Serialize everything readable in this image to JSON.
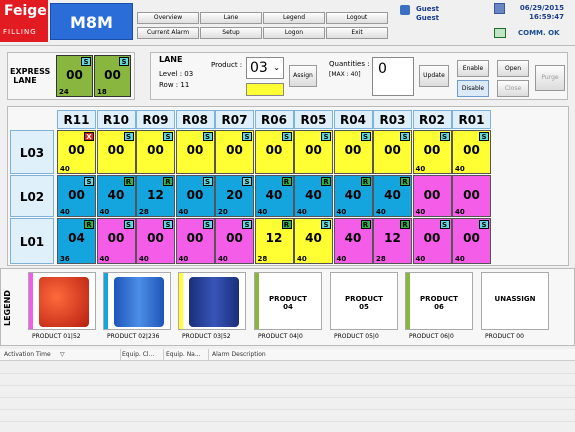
{
  "header": {
    "brand": "Feige",
    "brand_sub": "FILLING",
    "app_title": "M8M",
    "nav": [
      {
        "label": "Overview"
      },
      {
        "label": "Lane"
      },
      {
        "label": "Legend"
      },
      {
        "label": "Logout"
      },
      {
        "label": "Current Alarm"
      },
      {
        "label": "Setup"
      },
      {
        "label": "Logon"
      },
      {
        "label": "Exit"
      }
    ],
    "user_line1": "Guest",
    "user_line2": "Guest",
    "date": "06/29/2015",
    "time": "16:59:47",
    "comm_status": "COMM. OK"
  },
  "express_lane": {
    "label_line1": "EXPRESS",
    "label_line2": "LANE",
    "cells": [
      {
        "num": "00",
        "qty": "24",
        "badge": "S"
      },
      {
        "num": "00",
        "qty": "18",
        "badge": "S"
      }
    ]
  },
  "lane": {
    "title": "LANE",
    "level": "Level : 03",
    "row": "Row   : 11",
    "product_label": "Product :",
    "product_value": "03",
    "assign_label": "Assign",
    "quantities_label": "Quantities :",
    "max_label": "[MAX : 40]",
    "quantity_value": "0",
    "update_label": "Update",
    "enable_label": "Enable",
    "disable_label": "Disable",
    "open_label": "Open",
    "close_label": "Close",
    "purge_label": "Purge"
  },
  "grid": {
    "columns": [
      "R11",
      "R10",
      "R09",
      "R08",
      "R07",
      "R06",
      "R05",
      "R04",
      "R03",
      "R02",
      "R01"
    ],
    "rows": [
      {
        "label": "L03",
        "cells": [
          {
            "num": "00",
            "qty": "40",
            "badge": "X",
            "color": "y"
          },
          {
            "num": "00",
            "qty": "",
            "badge": "S",
            "color": "y"
          },
          {
            "num": "00",
            "qty": "",
            "badge": "S",
            "color": "y"
          },
          {
            "num": "00",
            "qty": "",
            "badge": "S",
            "color": "y"
          },
          {
            "num": "00",
            "qty": "",
            "badge": "S",
            "color": "y"
          },
          {
            "num": "00",
            "qty": "",
            "badge": "S",
            "color": "y"
          },
          {
            "num": "00",
            "qty": "",
            "badge": "S",
            "color": "y"
          },
          {
            "num": "00",
            "qty": "",
            "badge": "S",
            "color": "y"
          },
          {
            "num": "00",
            "qty": "",
            "badge": "S",
            "color": "y"
          },
          {
            "num": "00",
            "qty": "40",
            "badge": "S",
            "color": "y"
          },
          {
            "num": "00",
            "qty": "40",
            "badge": "S",
            "color": "y"
          }
        ]
      },
      {
        "label": "L02",
        "cells": [
          {
            "num": "00",
            "qty": "40",
            "badge": "S",
            "color": "b"
          },
          {
            "num": "40",
            "qty": "40",
            "badge": "R",
            "color": "b"
          },
          {
            "num": "12",
            "qty": "28",
            "badge": "R",
            "color": "b"
          },
          {
            "num": "00",
            "qty": "40",
            "badge": "S",
            "color": "b"
          },
          {
            "num": "20",
            "qty": "20",
            "badge": "S",
            "color": "b"
          },
          {
            "num": "40",
            "qty": "40",
            "badge": "R",
            "color": "b"
          },
          {
            "num": "40",
            "qty": "40",
            "badge": "R",
            "color": "b"
          },
          {
            "num": "40",
            "qty": "40",
            "badge": "R",
            "color": "b"
          },
          {
            "num": "40",
            "qty": "40",
            "badge": "R",
            "color": "b"
          },
          {
            "num": "00",
            "qty": "40",
            "badge": "",
            "color": "p"
          },
          {
            "num": "00",
            "qty": "40",
            "badge": "",
            "color": "p"
          }
        ]
      },
      {
        "label": "L01",
        "cells": [
          {
            "num": "04",
            "qty": "36",
            "badge": "R",
            "color": "b"
          },
          {
            "num": "00",
            "qty": "40",
            "badge": "S",
            "color": "p"
          },
          {
            "num": "00",
            "qty": "40",
            "badge": "S",
            "color": "p"
          },
          {
            "num": "00",
            "qty": "40",
            "badge": "S",
            "color": "p"
          },
          {
            "num": "00",
            "qty": "40",
            "badge": "S",
            "color": "p"
          },
          {
            "num": "12",
            "qty": "28",
            "badge": "R",
            "color": "y"
          },
          {
            "num": "40",
            "qty": "40",
            "badge": "S",
            "color": "y"
          },
          {
            "num": "40",
            "qty": "40",
            "badge": "R",
            "color": "p"
          },
          {
            "num": "12",
            "qty": "28",
            "badge": "R",
            "color": "p"
          },
          {
            "num": "00",
            "qty": "40",
            "badge": "S",
            "color": "p"
          },
          {
            "num": "00",
            "qty": "40",
            "badge": "S",
            "color": "p"
          }
        ]
      }
    ]
  },
  "legend": {
    "title": "LEGEND",
    "items": [
      {
        "caption": "PRODUCT 01|52",
        "text": "",
        "stripe": "#f45de8",
        "image": "total-drum-icon"
      },
      {
        "caption": "PRODUCT 02|236",
        "text": "",
        "stripe": "#14a5df",
        "image": "elf-drum-icon"
      },
      {
        "caption": "PRODUCT 03|52",
        "text": "",
        "stripe": "#ffff33",
        "image": "blue-drum-icon"
      },
      {
        "caption": "PRODUCT 04|0",
        "text": "PRODUCT\n04",
        "stripe": "#88b63f",
        "image": ""
      },
      {
        "caption": "PRODUCT 05|0",
        "text": "PRODUCT\n05",
        "stripe": "#ffffff",
        "image": ""
      },
      {
        "caption": "PRODUCT 06|0",
        "text": "PRODUCT\n06",
        "stripe": "#88b63f",
        "image": ""
      },
      {
        "caption": "PRODUCT 00",
        "text": "UNASSIGN",
        "stripe": "#ffffff",
        "image": ""
      }
    ]
  },
  "alarm_table": {
    "columns": [
      "Activation Time",
      "Equip. Cl...",
      "Equip. Na...",
      "Alarm Description"
    ]
  }
}
